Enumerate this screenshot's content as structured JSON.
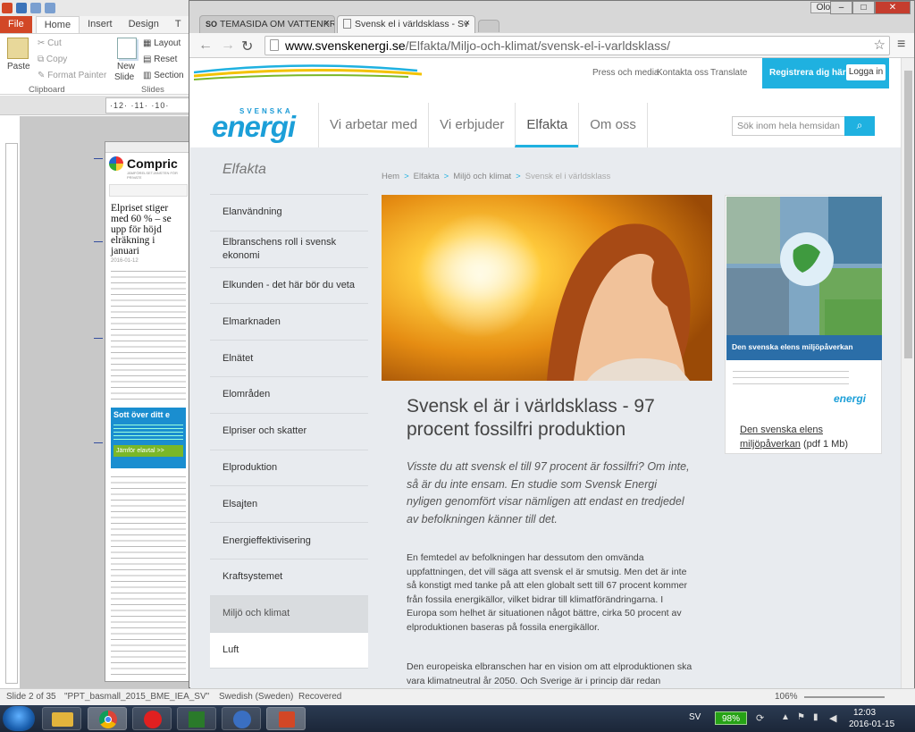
{
  "powerpoint": {
    "tabs": [
      "File",
      "Home",
      "Insert",
      "Design",
      "T"
    ],
    "clipboard": {
      "paste": "Paste",
      "cut": "Cut",
      "copy": "Copy",
      "format_painter": "Format Painter",
      "group": "Clipboard"
    },
    "slides": {
      "new_slide": "New",
      "new_slide2": "Slide",
      "layout": "Layout",
      "reset": "Reset",
      "section": "Section",
      "group": "Slides"
    },
    "ruler": "·12·  ·11·  ·10·",
    "mini": {
      "site": "Compric",
      "site_tag": "JÄMFÖRELSETJÄNSTEN FÖR PRIVATE",
      "headline": "Elpriset stiger med 60 % – se upp för höjd elräkning i januari",
      "date": "2016-01-12",
      "teaser": "Sott över ditt e",
      "button": "Jämför elavtal >>"
    },
    "status": {
      "slide": "Slide 2 of 35",
      "file": "\"PPT_basmall_2015_BME_IEA_SV\"",
      "lang": "Swedish (Sweden)",
      "recovered": "Recovered",
      "zoom": "106%"
    }
  },
  "browser": {
    "user": "Olof",
    "tabs": [
      {
        "label": "TEMASIDA OM VATTENKR",
        "favicon": "SO"
      },
      {
        "label": "Svensk el i världsklass - Sv"
      }
    ],
    "url_domain": "www.svenskenergi.se",
    "url_path": "/Elfakta/Miljo-och-klimat/svensk-el-i-varldsklass/"
  },
  "site": {
    "toplinks": [
      "Press och media",
      "Kontakta oss",
      "Translate"
    ],
    "register": "Registrera dig här",
    "login": "Logga in",
    "logo_top": "SVENSKA",
    "logo_main": "energi",
    "nav": [
      "Vi arbetar med",
      "Vi erbjuder",
      "Elfakta",
      "Om oss"
    ],
    "search_placeholder": "Sök inom hela hemsidan",
    "accent": "#1fb1e0"
  },
  "sidebar": {
    "title": "Elfakta",
    "items": [
      "Elanvändning",
      "Elbranschens roll i svensk ekonomi",
      "Elkunden - det här bör du veta",
      "Elmarknaden",
      "Elnätet",
      "Elområden",
      "Elpriser och skatter",
      "Elproduktion",
      "Elsajten",
      "Energieffektivisering",
      "Kraftsystemet",
      "Miljö och klimat",
      "Luft"
    ]
  },
  "breadcrumb": [
    "Hem",
    "Elfakta",
    "Miljö och klimat",
    "Svensk el i världsklass"
  ],
  "article": {
    "title": "Svensk el är i världsklass - 97 procent fossilfri produktion",
    "ingress": "Visste du att svensk el till 97 procent är fossilfri? Om inte, så är du inte ensam. En studie som Svensk Energi nyligen genomfört visar nämligen att endast en tredjedel av befolkningen känner till det.",
    "body1": "En femtedel av befolkningen har dessutom den omvända uppfattningen, det vill säga att svensk el är smutsig. Men det är inte så konstigt med tanke på att elen globalt sett till 67 procent kommer från fossila energikällor, vilket bidrar till klimatförändringarna. I Europa som helhet är situationen något bättre, cirka 50 procent av elproduktionen baseras på fossila energikällor.",
    "body2": "Den europeiska elbranschen har en vision om att elproduktionen ska vara klimatneutral år 2050. Och Sverige är i princip där redan"
  },
  "card": {
    "banner": "Den svenska elens miljöpåverkan",
    "logo": "energi",
    "link": "Den svenska elens miljöpåverkan",
    "suffix": "(pdf 1 Mb)"
  },
  "tray": {
    "lang": "SV",
    "battery": "98%",
    "time": "12:03",
    "date": "2016-01-15"
  }
}
